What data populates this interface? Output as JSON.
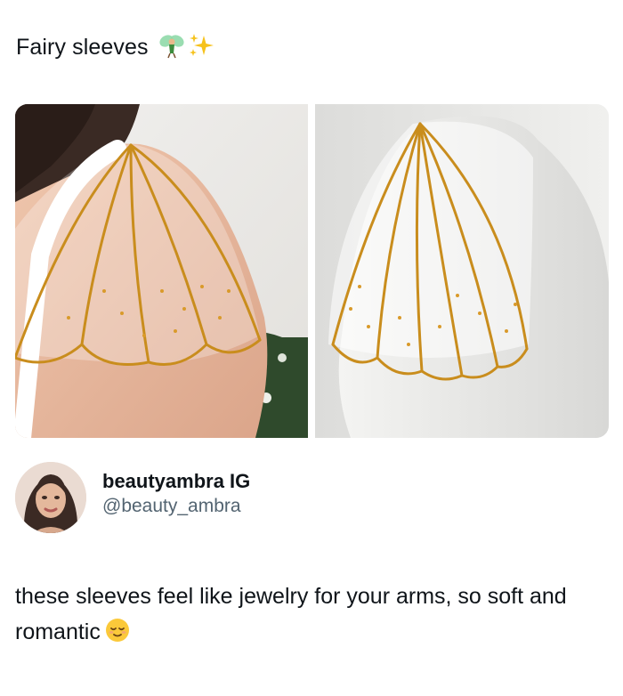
{
  "post": {
    "title": "Fairy sleeves",
    "title_emojis": [
      "fairy-emoji",
      "sparkles-emoji"
    ],
    "images": [
      {
        "name": "sleeve-worn-photo"
      },
      {
        "name": "sleeve-mannequin-photo"
      }
    ],
    "author": {
      "display_name": "beautyambra IG",
      "handle": "@beauty_ambra",
      "avatar": "avatar-portrait"
    },
    "body": "these sleeves feel like jewelry for your arms, so soft and romantic",
    "body_emoji": "relieved-face-emoji"
  },
  "colors": {
    "text": "#0f1419",
    "handle": "#536471",
    "gold_bead": "#c98d1d",
    "background": "#ffffff"
  }
}
